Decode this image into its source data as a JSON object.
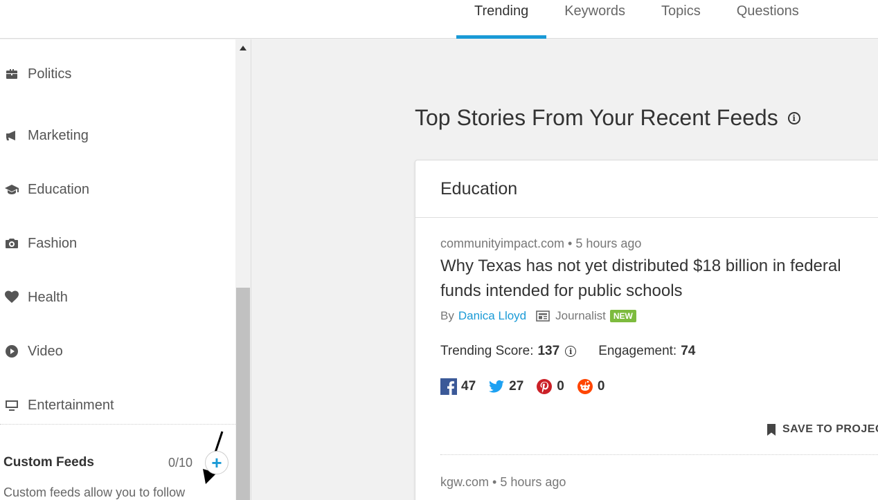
{
  "tabs": [
    {
      "label": "Trending"
    },
    {
      "label": "Keywords"
    },
    {
      "label": "Topics"
    },
    {
      "label": "Questions"
    }
  ],
  "sidebar": {
    "categories": [
      {
        "label": "Politics",
        "icon": "briefcase-icon"
      },
      {
        "label": "Marketing",
        "icon": "megaphone-icon"
      },
      {
        "label": "Education",
        "icon": "graduation-cap-icon"
      },
      {
        "label": "Fashion",
        "icon": "camera-icon"
      },
      {
        "label": "Health",
        "icon": "heart-icon"
      },
      {
        "label": "Video",
        "icon": "play-icon"
      },
      {
        "label": "Entertainment",
        "icon": "monitor-icon"
      }
    ],
    "custom_feeds": {
      "title": "Custom Feeds",
      "count": "0/10",
      "add_label": "+",
      "description": "Custom feeds allow you to follow"
    }
  },
  "main": {
    "title": "Top Stories From Your Recent Feeds",
    "card": {
      "heading": "Education",
      "story": {
        "meta": "communityimpact.com • 5 hours ago",
        "headline": "Why Texas has not yet distributed $18 billion in federal funds intended for public schools",
        "by": "By",
        "author": "Danica Lloyd",
        "role": "Journalist",
        "badge": "NEW",
        "trending_label": "Trending Score:",
        "trending_value": "137",
        "engagement_label": "Engagement:",
        "engagement_value": "74",
        "social": {
          "facebook": "47",
          "twitter": "27",
          "pinterest": "0",
          "reddit": "0"
        },
        "save_label": "SAVE TO PROJEC"
      },
      "story2_meta": "kgw.com • 5 hours ago"
    }
  },
  "colors": {
    "accent": "#1a9ad6",
    "badge": "#7dbb3e",
    "facebook": "#3b5998",
    "twitter": "#1da1f2",
    "pinterest": "#cb2027",
    "reddit": "#ff4500"
  }
}
